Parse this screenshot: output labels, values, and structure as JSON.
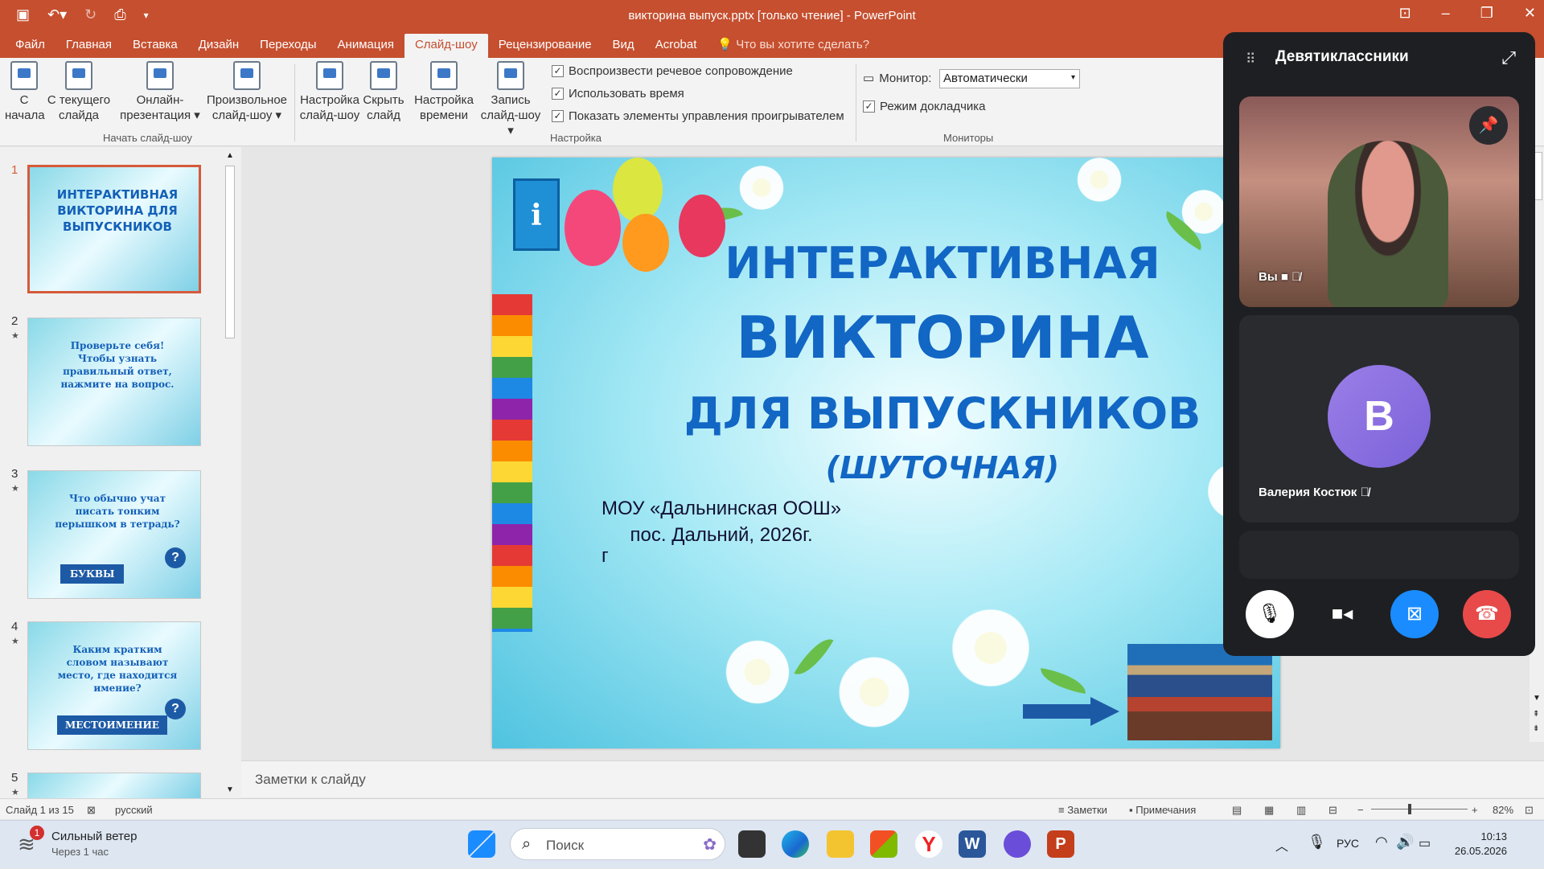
{
  "window": {
    "title": "викторина выпуск.pptx [только чтение] - PowerPoint"
  },
  "tabs": [
    {
      "label": "Файл"
    },
    {
      "label": "Главная"
    },
    {
      "label": "Вставка"
    },
    {
      "label": "Дизайн"
    },
    {
      "label": "Переходы"
    },
    {
      "label": "Анимация"
    },
    {
      "label": "Слайд-шоу"
    },
    {
      "label": "Рецензирование"
    },
    {
      "label": "Вид"
    },
    {
      "label": "Acrobat"
    }
  ],
  "tell_me": "Что вы хотите сделать?",
  "ribbon": {
    "from_start": {
      "l1": "С",
      "l2": "начала"
    },
    "from_current": {
      "l1": "С текущего",
      "l2": "слайда"
    },
    "online": {
      "l1": "Онлайн-",
      "l2": "презентация ▾"
    },
    "custom": {
      "l1": "Произвольное",
      "l2": "слайд-шоу ▾"
    },
    "group_start": "Начать слайд-шоу",
    "setup": {
      "l1": "Настройка",
      "l2": "слайд-шоу"
    },
    "hide": {
      "l1": "Скрыть",
      "l2": "слайд"
    },
    "rehearse": {
      "l1": "Настройка",
      "l2": "времени"
    },
    "record": {
      "l1": "Запись",
      "l2": "слайд-шоу ▾"
    },
    "chk_narration": "Воспроизвести речевое сопровождение",
    "chk_timings": "Использовать время",
    "chk_controls": "Показать элементы управления проигрывателем",
    "group_setup": "Настройка",
    "monitor_label": "Монитор:",
    "monitor_value": "Автоматически",
    "chk_presenter": "Режим докладчика",
    "group_monitors": "Мониторы"
  },
  "thumbnails": [
    {
      "num": "1",
      "text": "ИНТЕРАКТИВНАЯ ВИКТОРИНА ДЛЯ ВЫПУСКНИКОВ",
      "banner": ""
    },
    {
      "num": "2",
      "text": "Проверьте себя! Чтобы узнать правильный ответ, нажмите на вопрос.",
      "banner": ""
    },
    {
      "num": "3",
      "text": "Что обычно учат писать тонким перышком в тетрадь?",
      "banner": "БУКВЫ"
    },
    {
      "num": "4",
      "text": "Каким кратким словом называют место, где находится имение?",
      "banner": "МЕСТОИМЕНИЕ"
    },
    {
      "num": "5",
      "text": "",
      "banner": ""
    }
  ],
  "slide": {
    "line1": "ИНТЕРАКТИВНАЯ",
    "line2": "ВИКТОРИНА",
    "line3": "ДЛЯ ВЫПУСКНИКОВ",
    "line4": "(ШУТОЧНАЯ)",
    "org1": "МОУ «Дальнинская ООШ»",
    "org2": "пос. Дальний, 2026г.",
    "stray": "г"
  },
  "notes_placeholder": "Заметки к слайду",
  "status": {
    "slide_of": "Слайд 1 из 15",
    "language": "русский",
    "notes": "Заметки",
    "comments": "Примечания",
    "zoom": "82%",
    "zoom_percent": 82
  },
  "call": {
    "title": "Девятиклассники",
    "you_label": "Вы",
    "participant_initial": "В",
    "participant_name": "Валерия Костюк"
  },
  "taskbar": {
    "weather_title": "Сильный ветер",
    "weather_sub": "Через 1 час",
    "weather_badge": "1",
    "search": "Поиск",
    "lang": "РУС",
    "time": "10:13",
    "date": "26.05.2026"
  },
  "colors": {
    "accent": "#c54f2f",
    "call_bg": "#1e1f22",
    "screen_share": "#1a8cff",
    "hangup": "#e84a4a"
  }
}
